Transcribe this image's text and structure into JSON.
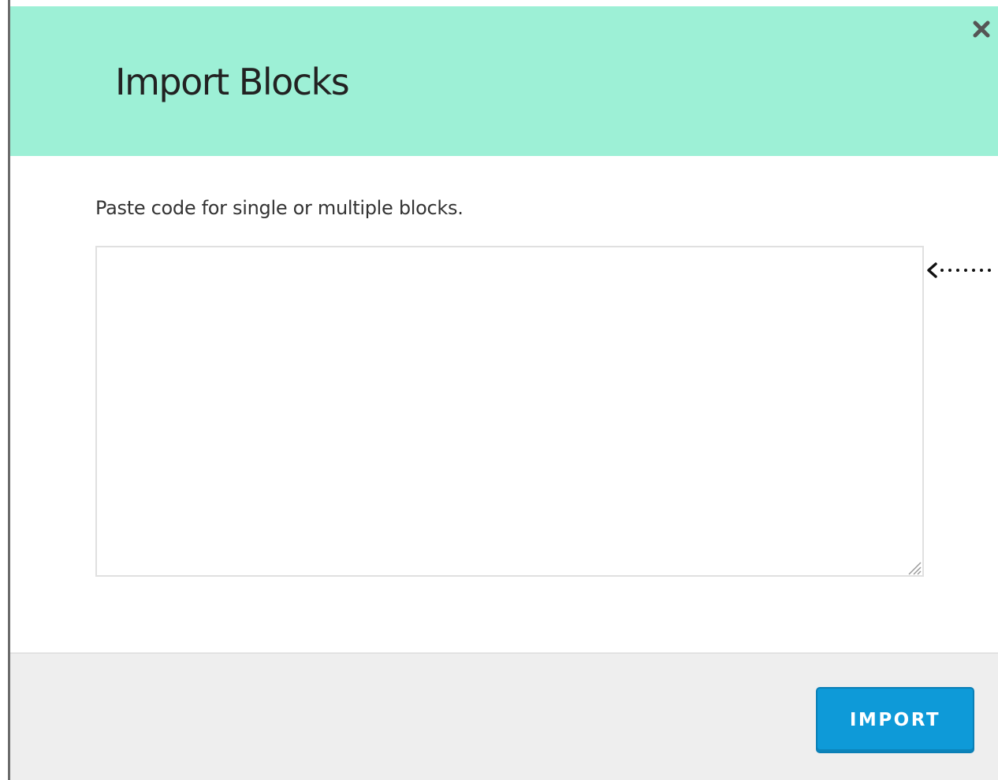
{
  "dialog": {
    "title": "Import Blocks",
    "close_icon": "close-icon",
    "instructions": "Paste code for single or multiple blocks.",
    "textarea": {
      "value": "",
      "placeholder": ""
    },
    "import_label": "IMPORT"
  },
  "colors": {
    "header_background": "#9df0d6",
    "footer_background": "#eeeeee",
    "import_button": "#0e9ad8"
  },
  "annotation": {
    "icon": "dotted-arrow-left-icon"
  }
}
